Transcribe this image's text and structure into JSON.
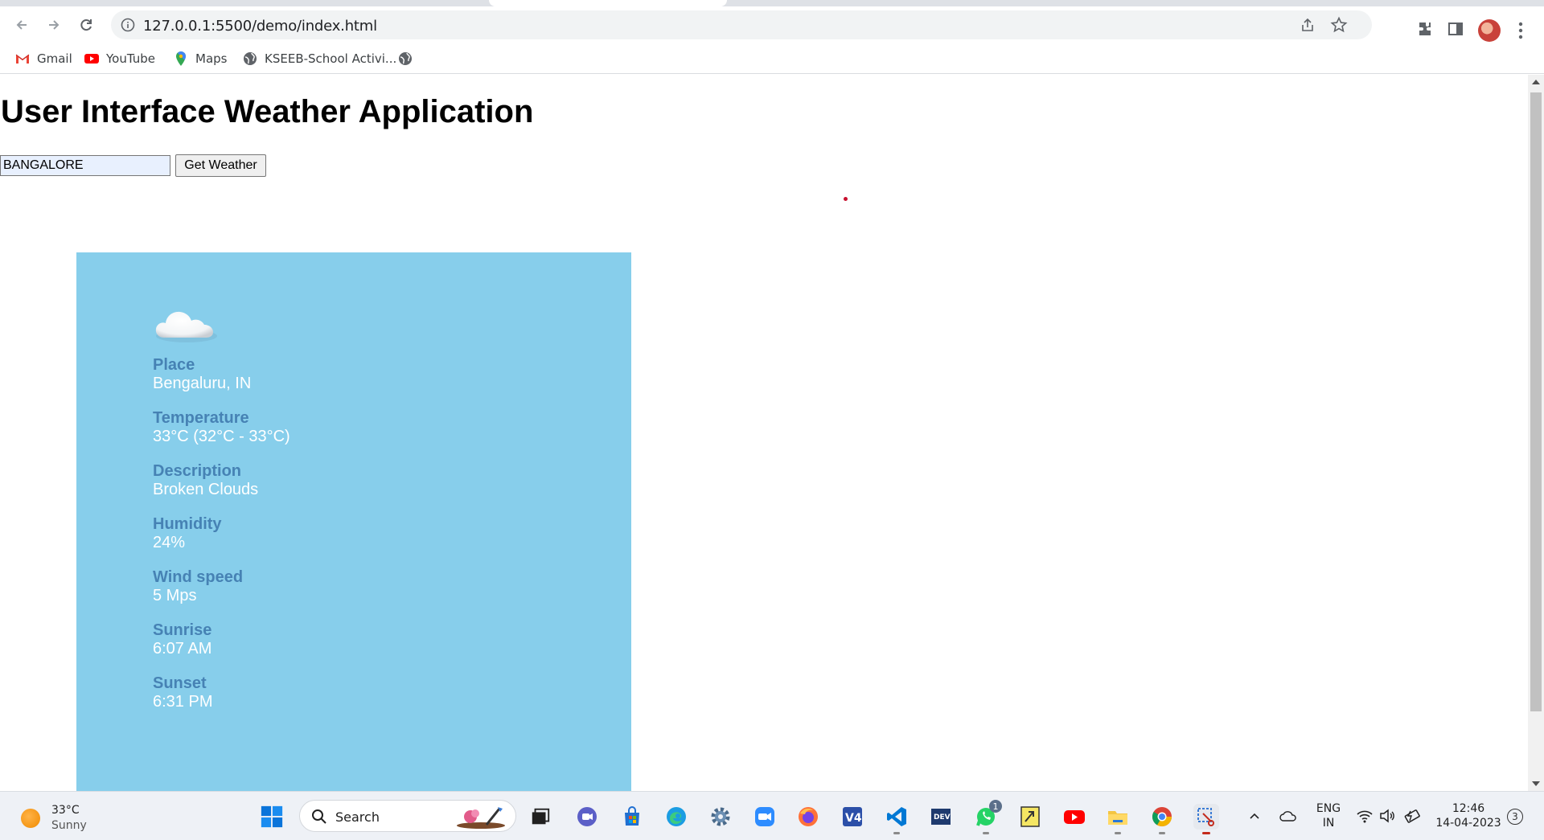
{
  "browser": {
    "url": "127.0.0.1:5500/demo/index.html",
    "bookmarks": [
      {
        "label": "Gmail",
        "icon": "gmail-icon"
      },
      {
        "label": "YouTube",
        "icon": "youtube-icon"
      },
      {
        "label": "Maps",
        "icon": "maps-icon"
      },
      {
        "label": "KSEEB-School Activi...",
        "icon": "globe-icon"
      },
      {
        "label": "",
        "icon": "globe-icon"
      }
    ]
  },
  "page": {
    "title": "User Interface Weather Application",
    "city_input_value": "BANGALORE",
    "get_button_label": "Get Weather"
  },
  "weather": {
    "icon": "cloud-icon",
    "fields": [
      {
        "label": "Place",
        "value": "Bengaluru, IN"
      },
      {
        "label": "Temperature",
        "value": "33°C (32°C - 33°C)"
      },
      {
        "label": "Description",
        "value": "Broken Clouds"
      },
      {
        "label": "Humidity",
        "value": "24%"
      },
      {
        "label": "Wind speed",
        "value": "5 Mps"
      },
      {
        "label": "Sunrise",
        "value": "6:07 AM"
      },
      {
        "label": "Sunset",
        "value": "6:31 PM"
      }
    ],
    "card_color": "#87ceeb",
    "label_color": "#4682b4",
    "value_color": "#ffffff"
  },
  "taskbar": {
    "weather_temp": "33°C",
    "weather_condition": "Sunny",
    "search_label": "Search",
    "whatsapp_badge": "1",
    "language_line1": "ENG",
    "language_line2": "IN",
    "time": "12:46",
    "date": "14-04-2023",
    "notification_count": "3"
  }
}
